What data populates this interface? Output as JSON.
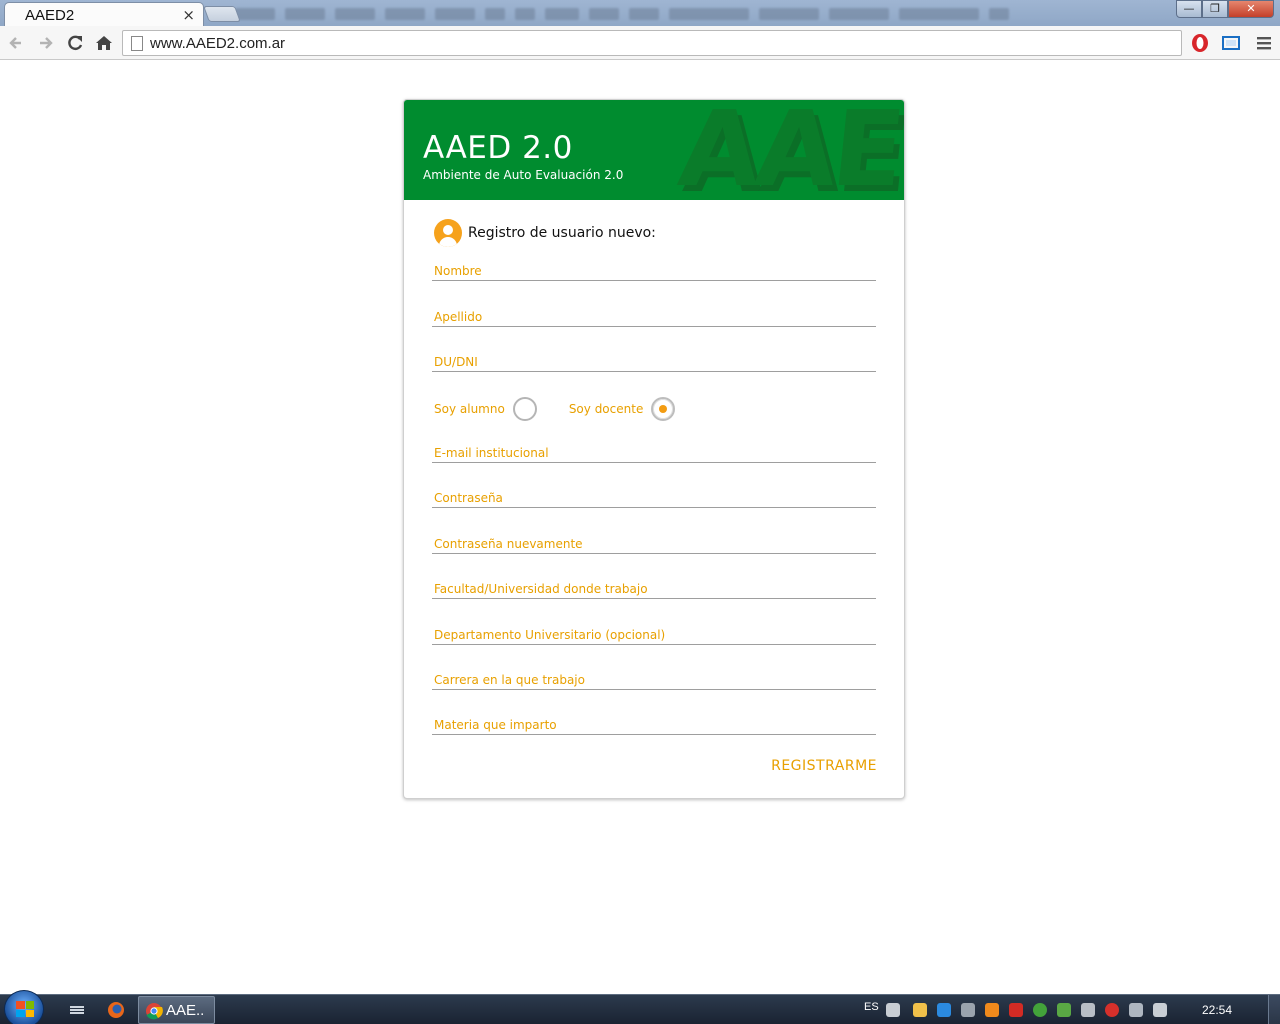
{
  "browser": {
    "tab_title": "AAED2",
    "tab_close": "×",
    "url": "www.AAED2.com.ar",
    "window_controls": {
      "minimize": "—",
      "maximize": "❐",
      "close": "✕"
    },
    "nav_icons": [
      "back-arrow-icon",
      "forward-arrow-icon",
      "reload-icon",
      "home-icon"
    ],
    "extension_icons": [
      "opera-icon",
      "screenshot-icon",
      "menu-icon"
    ]
  },
  "card": {
    "brand_color": "#008c2f",
    "accent_color": "#e8a000",
    "watermark": "AAED",
    "title": "AAED 2.0",
    "subtitle": "Ambiente de Auto Evaluación 2.0",
    "form_title": "Registro de usuario nuevo:",
    "fields": {
      "nombre": "Nombre",
      "apellido": "Apellido",
      "dni": "DU/DNI",
      "email": "E-mail institucional",
      "password": "Contraseña",
      "password_repeat": "Contraseña nuevamente",
      "facultad": "Facultad/Universidad donde trabajo",
      "departamento": "Departamento Universitario (opcional)",
      "carrera": "Carrera en la que trabajo",
      "materia": "Materia que imparto"
    },
    "role": {
      "student_label": "Soy alumno",
      "teacher_label": "Soy docente",
      "selected": "docente"
    },
    "submit_label": "REGISTRARME"
  },
  "taskbar": {
    "active_task_label": "AAE..",
    "language": "ES",
    "clock": "22:54"
  }
}
